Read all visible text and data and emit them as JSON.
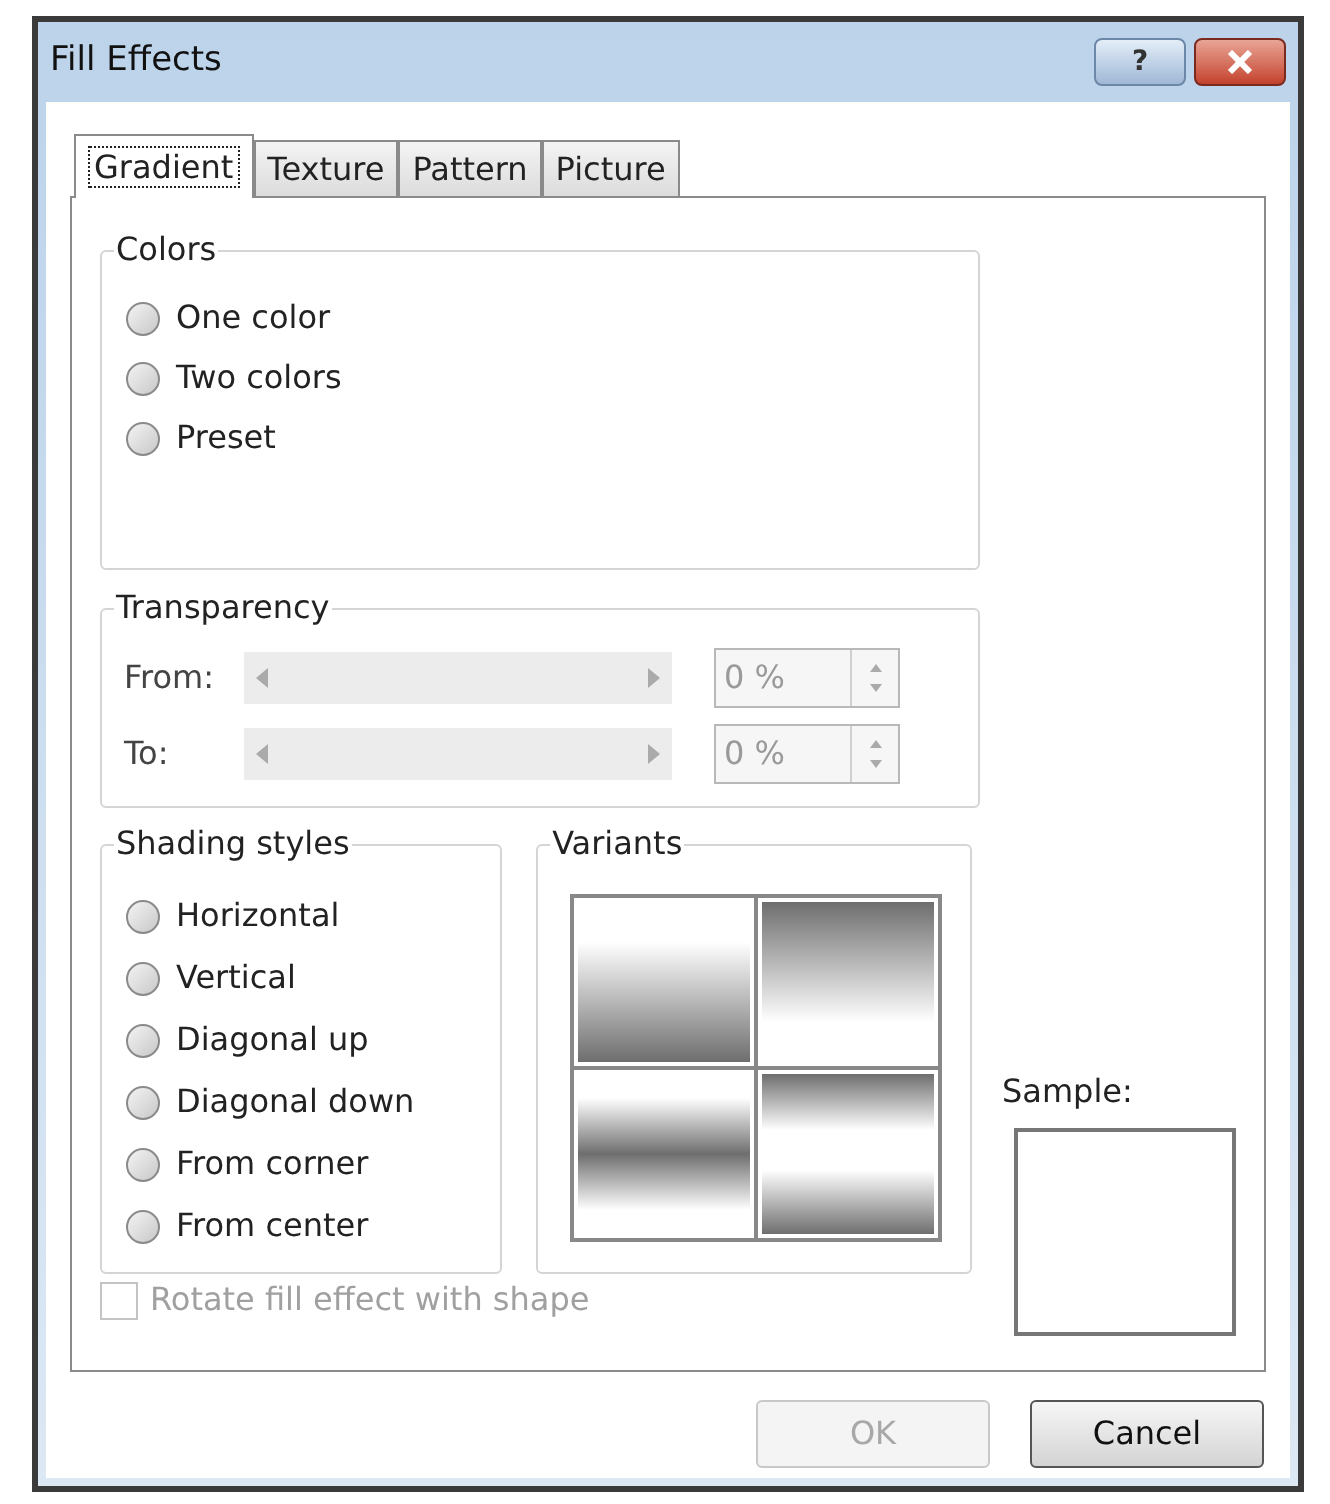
{
  "window": {
    "title": "Fill Effects",
    "help_button": "?"
  },
  "tabs": [
    {
      "label": "Gradient",
      "selected": true
    },
    {
      "label": "Texture",
      "selected": false
    },
    {
      "label": "Pattern",
      "selected": false
    },
    {
      "label": "Picture",
      "selected": false
    }
  ],
  "colors": {
    "title": "Colors",
    "options": [
      {
        "label": "One color",
        "selected": false
      },
      {
        "label": "Two colors",
        "selected": false
      },
      {
        "label": "Preset",
        "selected": false
      }
    ]
  },
  "transparency": {
    "title": "Transparency",
    "rows": [
      {
        "label": "From:",
        "value": "0 %",
        "disabled": true
      },
      {
        "label": "To:",
        "value": "0 %",
        "disabled": true
      }
    ]
  },
  "shading_styles": {
    "title": "Shading styles",
    "options": [
      {
        "label": "Horizontal",
        "selected": false
      },
      {
        "label": "Vertical",
        "selected": false
      },
      {
        "label": "Diagonal up",
        "selected": false
      },
      {
        "label": "Diagonal down",
        "selected": false
      },
      {
        "label": "From corner",
        "selected": false
      },
      {
        "label": "From center",
        "selected": false
      }
    ]
  },
  "variants": {
    "title": "Variants",
    "items": [
      {
        "kind": "dark-bottom"
      },
      {
        "kind": "dark-top"
      },
      {
        "kind": "dark-middle"
      },
      {
        "kind": "light-middle"
      }
    ]
  },
  "sample": {
    "label": "Sample:"
  },
  "rotate_checkbox": {
    "label": "Rotate fill effect with shape",
    "checked": false,
    "disabled": true
  },
  "buttons": [
    {
      "label": "OK",
      "disabled": true
    },
    {
      "label": "Cancel",
      "disabled": false
    }
  ]
}
